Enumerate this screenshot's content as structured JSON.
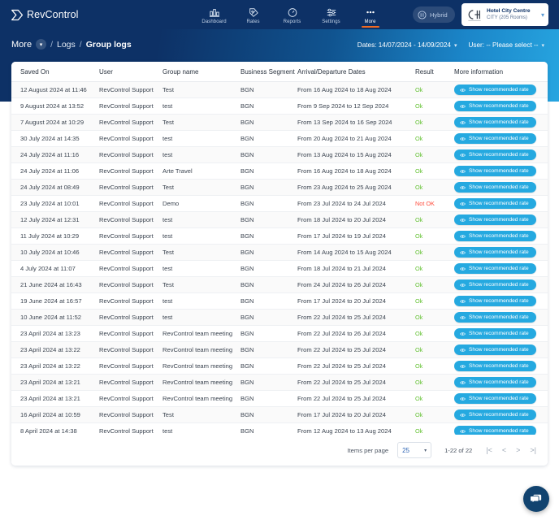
{
  "topbar": {
    "logo_text": "RevControl",
    "nav": [
      {
        "label": "Dashboard",
        "icon": "bar-chart-icon",
        "active": false
      },
      {
        "label": "Rates",
        "icon": "tag-percent-icon",
        "active": false
      },
      {
        "label": "Reports",
        "icon": "speedometer-icon",
        "active": false
      },
      {
        "label": "Settings",
        "icon": "sliders-icon",
        "active": false
      },
      {
        "label": "More",
        "icon": "ellipsis-icon",
        "active": true
      }
    ],
    "hybrid_badge": "Hybrid",
    "hotel": {
      "logo_initials": "CCH",
      "name": "Hotel City Centre",
      "subtitle": "CITY (205 Rooms)"
    }
  },
  "breadcrumb": {
    "root": "More",
    "separator": "/",
    "items": [
      "Logs",
      "Group logs"
    ]
  },
  "filters": {
    "dates_label": "Dates: 14/07/2024 - 14/09/2024",
    "user_label": "User: -- Please select --"
  },
  "table": {
    "columns": [
      "Saved On",
      "User",
      "Group name",
      "Business Segment",
      "Arrival/Departure Dates",
      "Result",
      "More information"
    ],
    "action_label": "Show recommended rate",
    "rows": [
      {
        "saved_on": "12 August 2024 at 11:46",
        "user": "RevControl Support",
        "group_name": "Test",
        "segment": "BGN",
        "dates": "From 16 Aug 2024 to 18 Aug 2024",
        "result": "Ok"
      },
      {
        "saved_on": "9 August 2024 at 13:52",
        "user": "RevControl Support",
        "group_name": "test",
        "segment": "BGN",
        "dates": "From 9 Sep 2024 to 12 Sep 2024",
        "result": "Ok"
      },
      {
        "saved_on": "7 August 2024 at 10:29",
        "user": "RevControl Support",
        "group_name": "Test",
        "segment": "BGN",
        "dates": "From 13 Sep 2024 to 16 Sep 2024",
        "result": "Ok"
      },
      {
        "saved_on": "30 July 2024 at 14:35",
        "user": "RevControl Support",
        "group_name": "test",
        "segment": "BGN",
        "dates": "From 20 Aug 2024 to 21 Aug 2024",
        "result": "Ok"
      },
      {
        "saved_on": "24 July 2024 at 11:16",
        "user": "RevControl Support",
        "group_name": "test",
        "segment": "BGN",
        "dates": "From 13 Aug 2024 to 15 Aug 2024",
        "result": "Ok"
      },
      {
        "saved_on": "24 July 2024 at 11:06",
        "user": "RevControl Support",
        "group_name": "Arte Travel",
        "segment": "BGN",
        "dates": "From 16 Aug 2024 to 18 Aug 2024",
        "result": "Ok"
      },
      {
        "saved_on": "24 July 2024 at 08:49",
        "user": "RevControl Support",
        "group_name": "Test",
        "segment": "BGN",
        "dates": "From 23 Aug 2024 to 25 Aug 2024",
        "result": "Ok"
      },
      {
        "saved_on": "23 July 2024 at 10:01",
        "user": "RevControl Support",
        "group_name": "Demo",
        "segment": "BGN",
        "dates": "From 23 Jul 2024 to 24 Jul 2024",
        "result": "Not OK"
      },
      {
        "saved_on": "12 July 2024 at 12:31",
        "user": "RevControl Support",
        "group_name": "test",
        "segment": "BGN",
        "dates": "From 18 Jul 2024 to 20 Jul 2024",
        "result": "Ok"
      },
      {
        "saved_on": "11 July 2024 at 10:29",
        "user": "RevControl Support",
        "group_name": "test",
        "segment": "BGN",
        "dates": "From 17 Jul 2024 to 19 Jul 2024",
        "result": "Ok"
      },
      {
        "saved_on": "10 July 2024 at 10:46",
        "user": "RevControl Support",
        "group_name": "Test",
        "segment": "BGN",
        "dates": "From 14 Aug 2024 to 15 Aug 2024",
        "result": "Ok"
      },
      {
        "saved_on": "4 July 2024 at 11:07",
        "user": "RevControl Support",
        "group_name": "test",
        "segment": "BGN",
        "dates": "From 18 Jul 2024 to 21 Jul 2024",
        "result": "Ok"
      },
      {
        "saved_on": "21 June 2024 at 16:43",
        "user": "RevControl Support",
        "group_name": "Test",
        "segment": "BGN",
        "dates": "From 24 Jul 2024 to 26 Jul 2024",
        "result": "Ok"
      },
      {
        "saved_on": "19 June 2024 at 16:57",
        "user": "RevControl Support",
        "group_name": "test",
        "segment": "BGN",
        "dates": "From 17 Jul 2024 to 20 Jul 2024",
        "result": "Ok"
      },
      {
        "saved_on": "10 June 2024 at 11:52",
        "user": "RevControl Support",
        "group_name": "test",
        "segment": "BGN",
        "dates": "From 22 Jul 2024 to 25 Jul 2024",
        "result": "Ok"
      },
      {
        "saved_on": "23 April 2024 at 13:23",
        "user": "RevControl Support",
        "group_name": "RevControl team meeting",
        "segment": "BGN",
        "dates": "From 22 Jul 2024 to 26 Jul 2024",
        "result": "Ok"
      },
      {
        "saved_on": "23 April 2024 at 13:22",
        "user": "RevControl Support",
        "group_name": "RevControl team meeting",
        "segment": "BGN",
        "dates": "From 22 Jul 2024 to 25 Jul 2024",
        "result": "Ok"
      },
      {
        "saved_on": "23 April 2024 at 13:22",
        "user": "RevControl Support",
        "group_name": "RevControl team meeting",
        "segment": "BGN",
        "dates": "From 22 Jul 2024 to 25 Jul 2024",
        "result": "Ok"
      },
      {
        "saved_on": "23 April 2024 at 13:21",
        "user": "RevControl Support",
        "group_name": "RevControl team meeting",
        "segment": "BGN",
        "dates": "From 22 Jul 2024 to 25 Jul 2024",
        "result": "Ok"
      },
      {
        "saved_on": "23 April 2024 at 13:21",
        "user": "RevControl Support",
        "group_name": "RevControl team meeting",
        "segment": "BGN",
        "dates": "From 22 Jul 2024 to 25 Jul 2024",
        "result": "Ok"
      },
      {
        "saved_on": "16 April 2024 at 10:59",
        "user": "RevControl Support",
        "group_name": "Test",
        "segment": "BGN",
        "dates": "From 17 Jul 2024 to 20 Jul 2024",
        "result": "Ok"
      },
      {
        "saved_on": "8 April 2024 at 14:38",
        "user": "RevControl Support",
        "group_name": "test",
        "segment": "BGN",
        "dates": "From 12 Aug 2024 to 13 Aug 2024",
        "result": "Ok"
      }
    ]
  },
  "pagination": {
    "items_per_page_label": "Items per page",
    "items_per_page_value": "25",
    "range_label": "1-22 of 22",
    "first": "|<",
    "prev": "<",
    "next": ">",
    "last": ">|"
  },
  "colors": {
    "navy": "#0d3166",
    "accent_blue": "#25a9e0",
    "orange": "#f26a21",
    "ok_green": "#63c132",
    "not_ok_red": "#ff4d3d"
  }
}
